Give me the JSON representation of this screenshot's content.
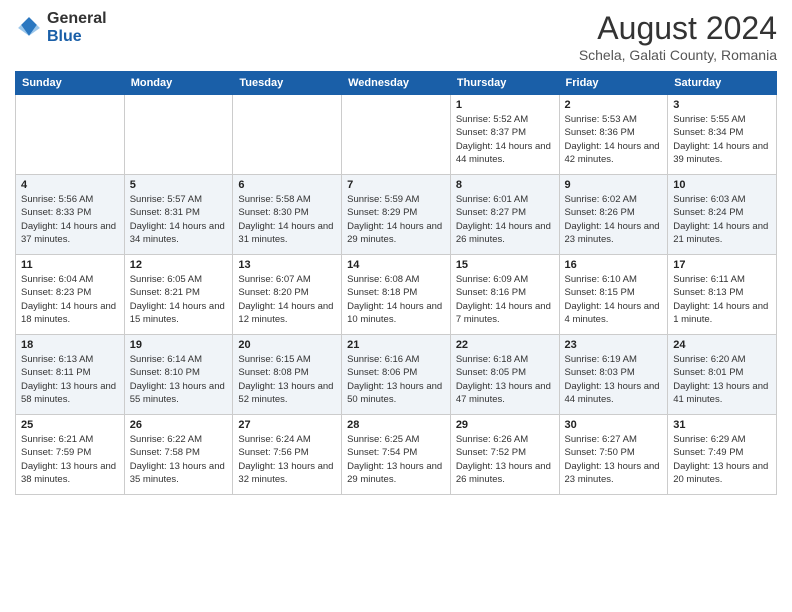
{
  "header": {
    "logo_general": "General",
    "logo_blue": "Blue",
    "month_year": "August 2024",
    "location": "Schela, Galati County, Romania"
  },
  "weekdays": [
    "Sunday",
    "Monday",
    "Tuesday",
    "Wednesday",
    "Thursday",
    "Friday",
    "Saturday"
  ],
  "weeks": [
    [
      null,
      null,
      null,
      null,
      {
        "day": "1",
        "sunrise": "5:52 AM",
        "sunset": "8:37 PM",
        "daylight": "14 hours and 44 minutes."
      },
      {
        "day": "2",
        "sunrise": "5:53 AM",
        "sunset": "8:36 PM",
        "daylight": "14 hours and 42 minutes."
      },
      {
        "day": "3",
        "sunrise": "5:55 AM",
        "sunset": "8:34 PM",
        "daylight": "14 hours and 39 minutes."
      }
    ],
    [
      {
        "day": "4",
        "sunrise": "5:56 AM",
        "sunset": "8:33 PM",
        "daylight": "14 hours and 37 minutes."
      },
      {
        "day": "5",
        "sunrise": "5:57 AM",
        "sunset": "8:31 PM",
        "daylight": "14 hours and 34 minutes."
      },
      {
        "day": "6",
        "sunrise": "5:58 AM",
        "sunset": "8:30 PM",
        "daylight": "14 hours and 31 minutes."
      },
      {
        "day": "7",
        "sunrise": "5:59 AM",
        "sunset": "8:29 PM",
        "daylight": "14 hours and 29 minutes."
      },
      {
        "day": "8",
        "sunrise": "6:01 AM",
        "sunset": "8:27 PM",
        "daylight": "14 hours and 26 minutes."
      },
      {
        "day": "9",
        "sunrise": "6:02 AM",
        "sunset": "8:26 PM",
        "daylight": "14 hours and 23 minutes."
      },
      {
        "day": "10",
        "sunrise": "6:03 AM",
        "sunset": "8:24 PM",
        "daylight": "14 hours and 21 minutes."
      }
    ],
    [
      {
        "day": "11",
        "sunrise": "6:04 AM",
        "sunset": "8:23 PM",
        "daylight": "14 hours and 18 minutes."
      },
      {
        "day": "12",
        "sunrise": "6:05 AM",
        "sunset": "8:21 PM",
        "daylight": "14 hours and 15 minutes."
      },
      {
        "day": "13",
        "sunrise": "6:07 AM",
        "sunset": "8:20 PM",
        "daylight": "14 hours and 12 minutes."
      },
      {
        "day": "14",
        "sunrise": "6:08 AM",
        "sunset": "8:18 PM",
        "daylight": "14 hours and 10 minutes."
      },
      {
        "day": "15",
        "sunrise": "6:09 AM",
        "sunset": "8:16 PM",
        "daylight": "14 hours and 7 minutes."
      },
      {
        "day": "16",
        "sunrise": "6:10 AM",
        "sunset": "8:15 PM",
        "daylight": "14 hours and 4 minutes."
      },
      {
        "day": "17",
        "sunrise": "6:11 AM",
        "sunset": "8:13 PM",
        "daylight": "14 hours and 1 minute."
      }
    ],
    [
      {
        "day": "18",
        "sunrise": "6:13 AM",
        "sunset": "8:11 PM",
        "daylight": "13 hours and 58 minutes."
      },
      {
        "day": "19",
        "sunrise": "6:14 AM",
        "sunset": "8:10 PM",
        "daylight": "13 hours and 55 minutes."
      },
      {
        "day": "20",
        "sunrise": "6:15 AM",
        "sunset": "8:08 PM",
        "daylight": "13 hours and 52 minutes."
      },
      {
        "day": "21",
        "sunrise": "6:16 AM",
        "sunset": "8:06 PM",
        "daylight": "13 hours and 50 minutes."
      },
      {
        "day": "22",
        "sunrise": "6:18 AM",
        "sunset": "8:05 PM",
        "daylight": "13 hours and 47 minutes."
      },
      {
        "day": "23",
        "sunrise": "6:19 AM",
        "sunset": "8:03 PM",
        "daylight": "13 hours and 44 minutes."
      },
      {
        "day": "24",
        "sunrise": "6:20 AM",
        "sunset": "8:01 PM",
        "daylight": "13 hours and 41 minutes."
      }
    ],
    [
      {
        "day": "25",
        "sunrise": "6:21 AM",
        "sunset": "7:59 PM",
        "daylight": "13 hours and 38 minutes."
      },
      {
        "day": "26",
        "sunrise": "6:22 AM",
        "sunset": "7:58 PM",
        "daylight": "13 hours and 35 minutes."
      },
      {
        "day": "27",
        "sunrise": "6:24 AM",
        "sunset": "7:56 PM",
        "daylight": "13 hours and 32 minutes."
      },
      {
        "day": "28",
        "sunrise": "6:25 AM",
        "sunset": "7:54 PM",
        "daylight": "13 hours and 29 minutes."
      },
      {
        "day": "29",
        "sunrise": "6:26 AM",
        "sunset": "7:52 PM",
        "daylight": "13 hours and 26 minutes."
      },
      {
        "day": "30",
        "sunrise": "6:27 AM",
        "sunset": "7:50 PM",
        "daylight": "13 hours and 23 minutes."
      },
      {
        "day": "31",
        "sunrise": "6:29 AM",
        "sunset": "7:49 PM",
        "daylight": "13 hours and 20 minutes."
      }
    ]
  ]
}
